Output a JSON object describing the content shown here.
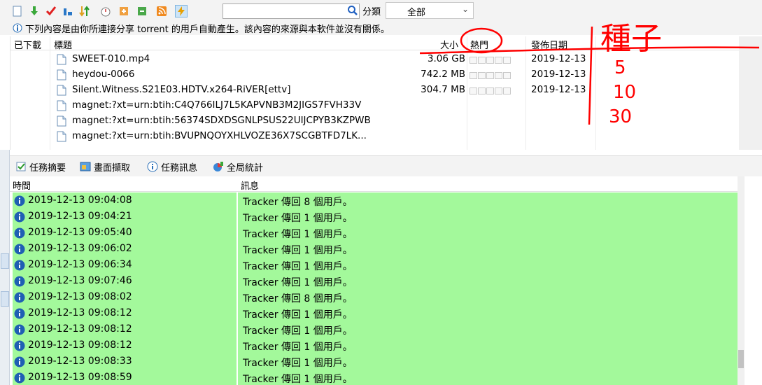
{
  "toolbar": {
    "search_value": "",
    "category_label": "分類",
    "category_value": "全部"
  },
  "info_line": "下列內容是由你所連接分享 torrent 的用戶自動產生。該內容的來源與本軟件並沒有關係。",
  "file_list": {
    "columns": {
      "downloaded": "已下載",
      "title": "標題",
      "size": "大小",
      "hot": "熱門",
      "date": "發佈日期"
    },
    "rows": [
      {
        "title": "SWEET-010.mp4",
        "size": "3.06 GB",
        "date": "2019-12-13",
        "hot": true
      },
      {
        "title": "heydou-0066",
        "size": "742.2 MB",
        "date": "2019-12-13",
        "hot": true
      },
      {
        "title": "Silent.Witness.S21E03.HDTV.x264-RiVER[ettv]",
        "size": "304.7 MB",
        "date": "2019-12-13",
        "hot": true
      },
      {
        "title": "magnet:?xt=urn:btih:C4Q766ILJ7L5KAPVNB3M2JIGS7FVH33V",
        "size": "",
        "date": "",
        "hot": false
      },
      {
        "title": "magnet:?xt=urn:btih:56374SDXDSGNLPSUS22UIJCPYB3KZPWB",
        "size": "",
        "date": "",
        "hot": false
      },
      {
        "title": "magnet:?xt=urn:btih:BVUPNQOYXHLVOZE36X7SCGBTFD7LK...",
        "size": "",
        "date": "",
        "hot": false
      }
    ]
  },
  "tabs": [
    {
      "label": "任務摘要",
      "icon": "task-summary-icon"
    },
    {
      "label": "畫面擷取",
      "icon": "screen-capture-icon"
    },
    {
      "label": "任務訊息",
      "icon": "info-icon"
    },
    {
      "label": "全局統計",
      "icon": "global-stats-icon"
    }
  ],
  "log": {
    "columns": {
      "time": "時間",
      "message": "訊息"
    },
    "row_color": "#a3f99b",
    "rows": [
      {
        "time": "2019-12-13 09:04:08",
        "message": "Tracker 傳回 8 個用戶。"
      },
      {
        "time": "2019-12-13 09:04:21",
        "message": "Tracker 傳回 1 個用戶。"
      },
      {
        "time": "2019-12-13 09:05:40",
        "message": "Tracker 傳回 1 個用戶。"
      },
      {
        "time": "2019-12-13 09:06:02",
        "message": "Tracker 傳回 1 個用戶。"
      },
      {
        "time": "2019-12-13 09:06:34",
        "message": "Tracker 傳回 1 個用戶。"
      },
      {
        "time": "2019-12-13 09:07:46",
        "message": "Tracker 傳回 1 個用戶。"
      },
      {
        "time": "2019-12-13 09:08:02",
        "message": "Tracker 傳回 8 個用戶。"
      },
      {
        "time": "2019-12-13 09:08:12",
        "message": "Tracker 傳回 1 個用戶。"
      },
      {
        "time": "2019-12-13 09:08:12",
        "message": "Tracker 傳回 1 個用戶。"
      },
      {
        "time": "2019-12-13 09:08:12",
        "message": "Tracker 傳回 1 個用戶。"
      },
      {
        "time": "2019-12-13 09:08:33",
        "message": "Tracker 傳回 1 個用戶。"
      },
      {
        "time": "2019-12-13 09:08:59",
        "message": "Tracker 傳回 1 個用戶。"
      }
    ]
  },
  "annotation": {
    "heading": "種子",
    "values": [
      "5",
      "10",
      "30"
    ],
    "color": "#ff0000"
  }
}
